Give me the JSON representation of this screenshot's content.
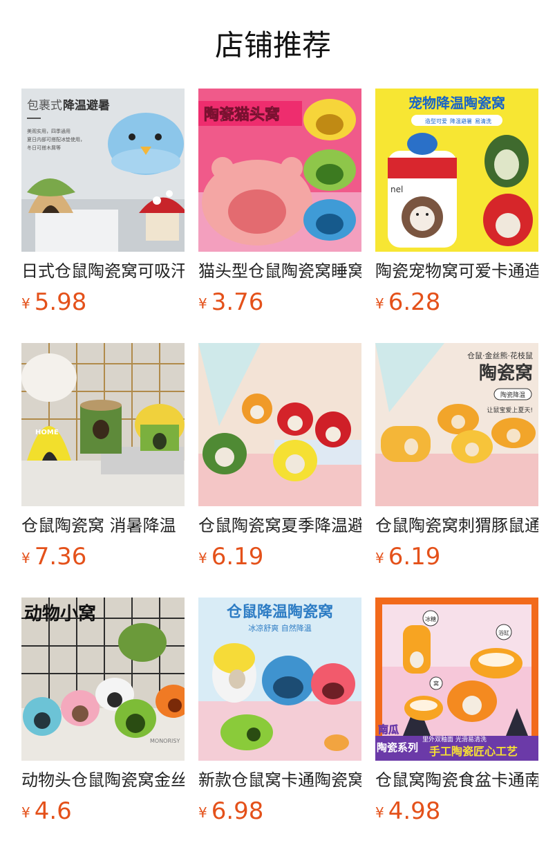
{
  "page": {
    "title": "店铺推荐"
  },
  "products": [
    {
      "name": "日式仓鼠陶瓷窝可吸汗",
      "currency": "¥",
      "price": "5.98",
      "image_text": {
        "t1": "包裹式",
        "t2": "降温避暑",
        "b1": "美观实用，四季通用",
        "b2": "夏日内部可搭配冰垫使用，",
        "b3": "冬日可搭木屑等"
      },
      "image_icon": "penguin-mushroom-ceramic-nests-icon"
    },
    {
      "name": "猫头型仓鼠陶瓷窝睡窝",
      "currency": "¥",
      "price": "3.76",
      "image_text": {
        "t1": "陶瓷猫头窝"
      },
      "image_icon": "cat-head-ceramic-nests-icon"
    },
    {
      "name": "陶瓷宠物窝可爱卡通造型",
      "currency": "¥",
      "price": "6.28",
      "image_text": {
        "t1": "宠物降温陶瓷窝",
        "b1": "造型可爱",
        "b2": "降温避暑",
        "b3": "易清洗",
        "b4": "nel"
      },
      "image_icon": "bottle-fruit-ceramic-nests-icon"
    },
    {
      "name": "仓鼠陶瓷窝 消暑降温",
      "currency": "¥",
      "price": "7.36",
      "image_text": {
        "t1": "HOME"
      },
      "image_icon": "beehive-stump-mushroom-nests-icon"
    },
    {
      "name": "仓鼠陶瓷窝夏季降温避暑",
      "currency": "¥",
      "price": "6.19",
      "image_text": {},
      "image_icon": "fruit-ceramic-nests-icon"
    },
    {
      "name": "仓鼠陶瓷窝刺猬豚鼠通用",
      "currency": "¥",
      "price": "6.19",
      "image_text": {
        "t1": "仓鼠·金丝熊·花枝鼠",
        "t2": "陶瓷窝",
        "b1": "陶瓷降温",
        "b2": "让鼠宝爱上夏天!"
      },
      "image_icon": "bread-ceramic-nests-icon"
    },
    {
      "name": "动物头仓鼠陶瓷窝金丝熊",
      "currency": "¥",
      "price": "4.6",
      "image_text": {
        "t1": "动物小窝",
        "b1": "MONORISY"
      },
      "image_icon": "animal-head-ceramic-nests-icon"
    },
    {
      "name": "新款仓鼠窝卡通陶瓷窝",
      "currency": "¥",
      "price": "6.98",
      "image_text": {
        "t1": "仓鼠降温陶瓷窝",
        "t2": "冰凉舒爽 自然降温"
      },
      "image_icon": "shark-egg-monster-nests-icon"
    },
    {
      "name": "仓鼠窝陶瓷食盆卡通南瓜",
      "currency": "¥",
      "price": "4.98",
      "image_text": {
        "t1": "南瓜",
        "t2": "陶瓷系列",
        "t3": "手工陶瓷匠心工艺",
        "b1": "里外双釉面 光滑易清洗",
        "b2": "冰糖",
        "b3": "浴缸",
        "b4": "窝"
      },
      "image_icon": "pumpkin-ceramic-nests-icon"
    }
  ]
}
